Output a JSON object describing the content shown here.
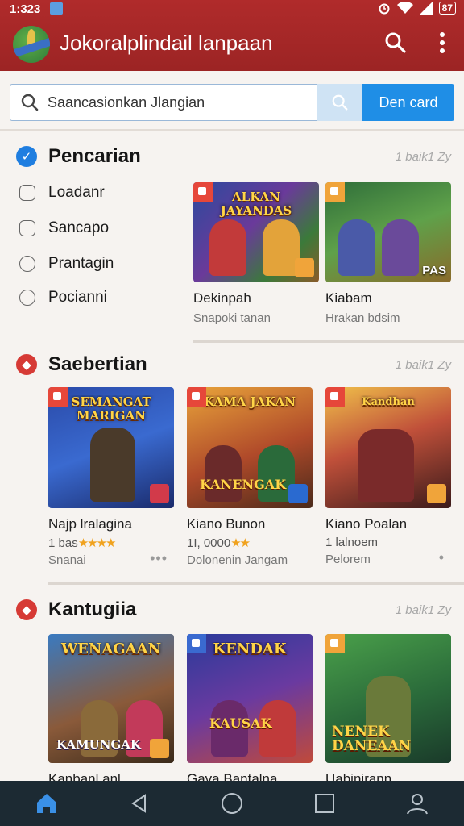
{
  "status_bar": {
    "time": "1:323",
    "battery": "87"
  },
  "app_bar": {
    "title": "Jokoralplindail lanpaan",
    "icons": [
      "search-icon",
      "more-vert-icon"
    ]
  },
  "search": {
    "value": "Saancasionkan Jlangian",
    "button_label": "Den card"
  },
  "filters_section": {
    "title": "Pencarian",
    "more": "1 baik1 Zy",
    "options": [
      {
        "label": "Loadanr"
      },
      {
        "label": "Sancapo"
      },
      {
        "label": "Prantagin"
      },
      {
        "label": "Pocianni"
      }
    ],
    "cards": [
      {
        "banner": "ALKAN JAYANDAS",
        "name": "Dekinpah",
        "sub": "Snapoki tanan"
      },
      {
        "banner": "",
        "name": "Kiabam",
        "sub": "Hrakan bdsim",
        "logo": "PAS"
      }
    ]
  },
  "section2": {
    "title": "Saebertian",
    "more": "1 baik1 Zy",
    "cards": [
      {
        "banner": "SEMANGAT MARIGAN",
        "name": "Najp lralagina",
        "rating_text": "1 bas",
        "stars": "★★★★",
        "sub": "Snanai"
      },
      {
        "banner": "KAMA JAKAN",
        "name": "Kiano Bunon",
        "rating_text": "1I, 0000",
        "stars": "★★",
        "sub": "Dolonenin Jangam"
      },
      {
        "banner": "Kandhan",
        "name": "Kiano Poalan",
        "rating_text": "1 lalnoem",
        "stars": "",
        "sub": "Pelorem"
      }
    ],
    "overlay_texts": [
      "KANENGAK"
    ]
  },
  "section3": {
    "title": "Kantugiia",
    "more": "1 baik1 Zy",
    "cards": [
      {
        "banner": "WENAGAAN",
        "name": "Kanbanl anl",
        "overlay": "KAMUNGAK"
      },
      {
        "banner": "KENDAK",
        "name": "Gava Bantalna",
        "overlay": "KAUSAK"
      },
      {
        "banner": "",
        "name": "Uabinjrann",
        "overlay": "NENEK DANEAAN"
      }
    ]
  },
  "colors": {
    "app_bar": "#a32727",
    "accent_blue": "#1f8ee6",
    "section_badge_red": "#d63a35",
    "check_blue": "#1f7ee0",
    "bottom_nav": "#1c2a33"
  },
  "bottom_nav": [
    "home-icon",
    "back-icon",
    "circle-home-icon",
    "recents-icon",
    "profile-icon"
  ]
}
